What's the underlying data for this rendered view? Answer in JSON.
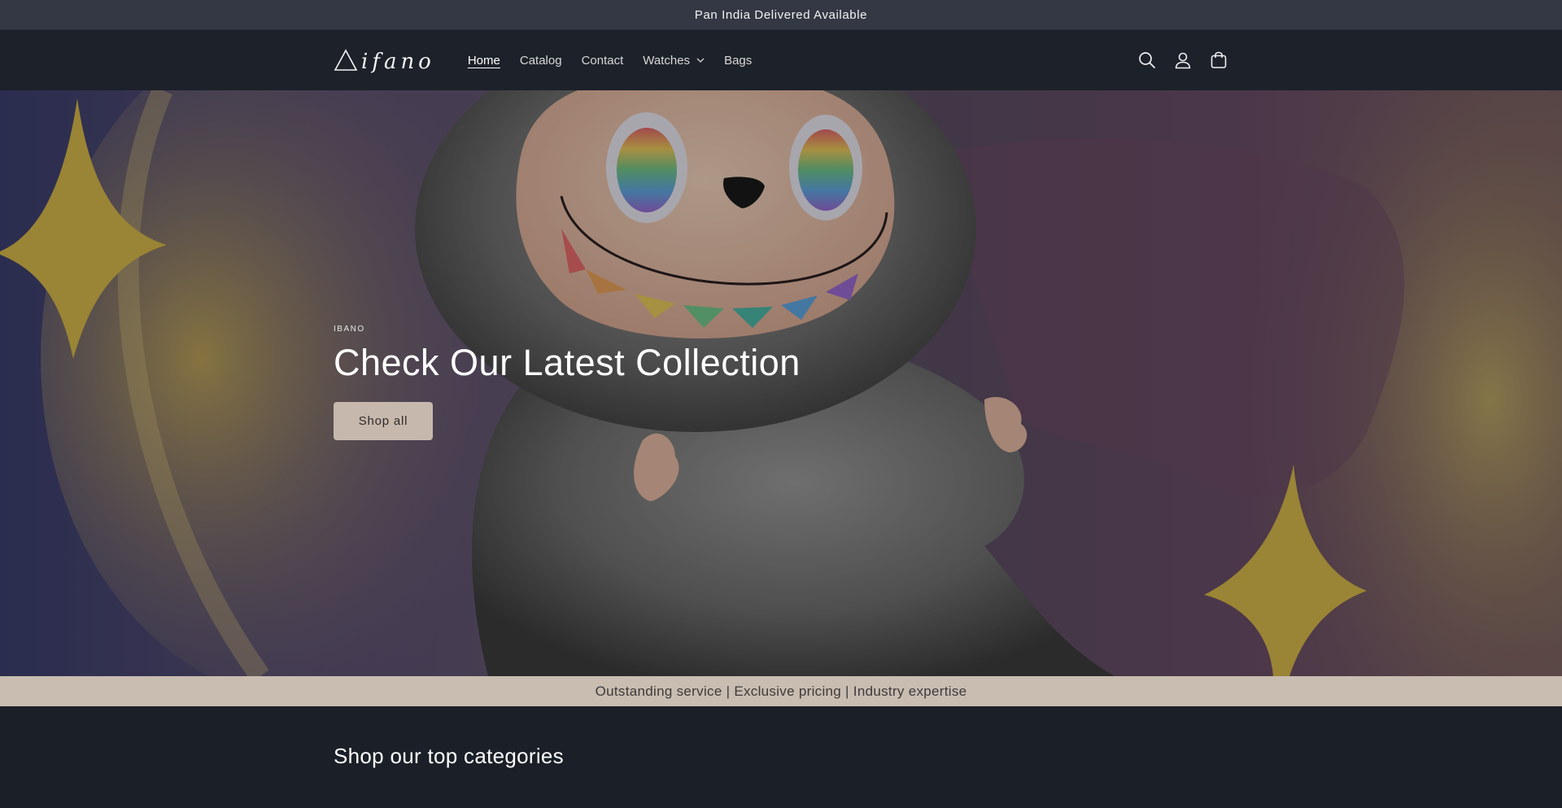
{
  "announcement": {
    "text": "Pan India Delivered Available"
  },
  "header": {
    "logo_text": "ifano",
    "nav": [
      {
        "label": "Home",
        "active": true
      },
      {
        "label": "Catalog"
      },
      {
        "label": "Contact"
      },
      {
        "label": "Watches",
        "has_dropdown": true
      },
      {
        "label": "Bags"
      }
    ],
    "icons": [
      "search-icon",
      "account-icon",
      "cart-icon"
    ]
  },
  "hero": {
    "kicker": "IBANO",
    "title": "Check Our Latest Collection",
    "button_label": "Shop all"
  },
  "strip": {
    "text": "Outstanding service | Exclusive pricing | Industry expertise"
  },
  "categories": {
    "title": "Shop our top categories"
  },
  "colors": {
    "announcement_bg": "#343844",
    "header_bg": "#1d212a",
    "button_bg": "#c6b8ac",
    "strip_bg": "#c9bdb1",
    "page_bg": "#1b1f27"
  }
}
